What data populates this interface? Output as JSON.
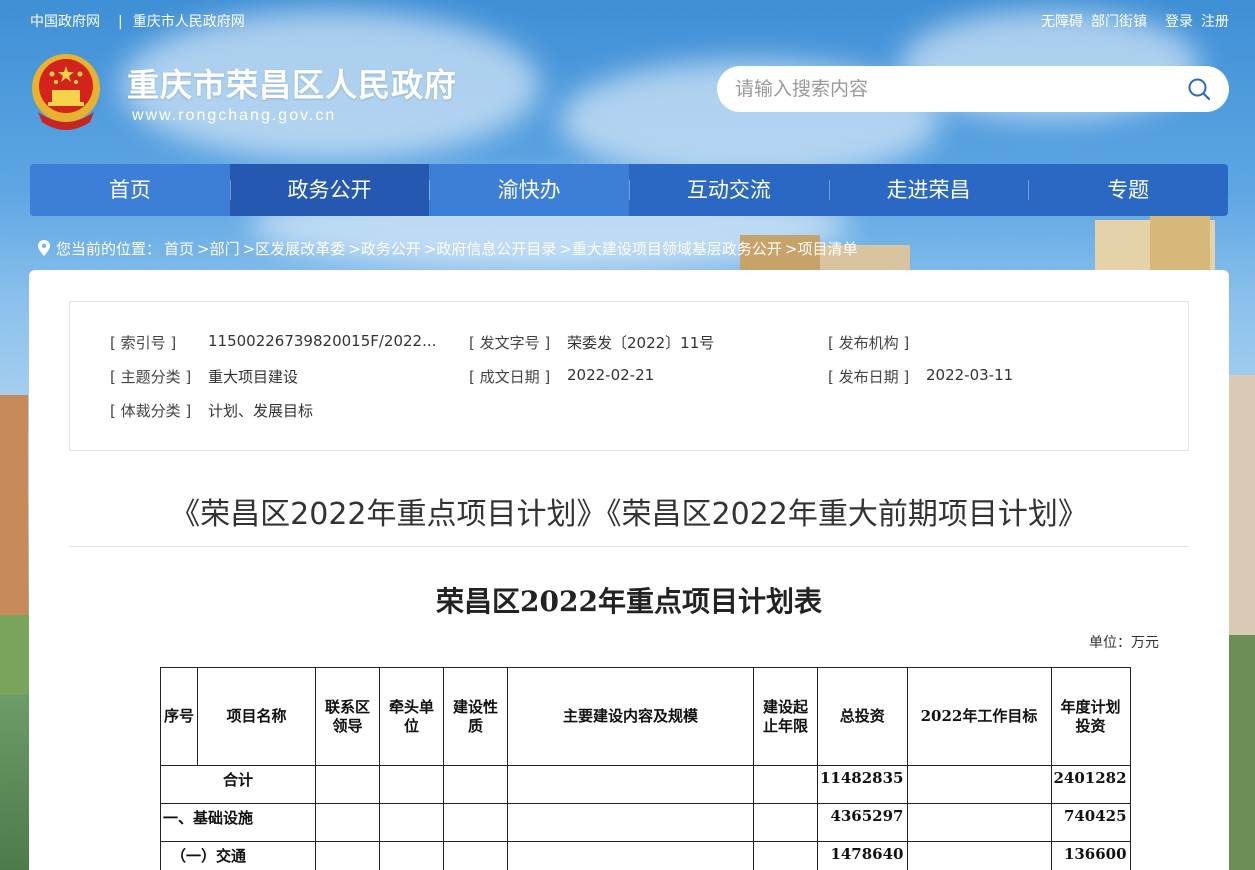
{
  "topbar": {
    "links_left": [
      "中国政府网",
      "|",
      "重庆市人民政府网"
    ],
    "links_right": [
      "无障碍",
      "部门街镇",
      "登录",
      "注册"
    ]
  },
  "header": {
    "site_title": "重庆市荣昌区人民政府",
    "site_url": "www.rongchang.gov.cn",
    "search_placeholder": "请输入搜索内容"
  },
  "nav": {
    "items": [
      "首页",
      "政务公开",
      "渝快办",
      "互动交流",
      "走进荣昌",
      "专题"
    ]
  },
  "breadcrumb": {
    "prefix": "您当前的位置：",
    "items": [
      "首页",
      ">部门",
      ">区发展改革委",
      ">政务公开",
      ">政府信息公开目录",
      ">重大建设项目领域基层政务公开",
      ">项目清单"
    ]
  },
  "meta": {
    "index_label": "[ 索引号 ]",
    "index_value": "11500226739820015F/2022...",
    "doc_no_label": "[ 发文字号 ]",
    "doc_no_value": "荣委发〔2022〕11号",
    "issuer_label": "[ 发布机构 ]",
    "issuer_value": "",
    "topic_label": "[ 主题分类 ]",
    "topic_value": "重大项目建设",
    "created_label": "[ 成文日期 ]",
    "created_value": "2022-02-21",
    "published_label": "[ 发布日期 ]",
    "published_value": "2022-03-11",
    "genre_label": "[ 体裁分类 ]",
    "genre_value": "计划、发展目标"
  },
  "article": {
    "title": "《荣昌区2022年重点项目计划》《荣昌区2022年重大前期项目计划》",
    "table_title": "荣昌区2022年重点项目计划表",
    "unit": "单位：万元"
  },
  "table": {
    "headers": [
      "序号",
      "项目名称",
      "联系区领导",
      "牵头单位",
      "建设性质",
      "主要建设内容及规模",
      "建设起止年限",
      "总投资",
      "2022年工作目标",
      "年度计划投资"
    ],
    "rows": [
      {
        "label": "合计",
        "total": "11482835",
        "annual": "2401282"
      },
      {
        "label": "一、基础设施",
        "total": "4365297",
        "annual": "740425"
      },
      {
        "label": "（一）交通",
        "total": "1478640",
        "annual": "136600"
      }
    ]
  }
}
